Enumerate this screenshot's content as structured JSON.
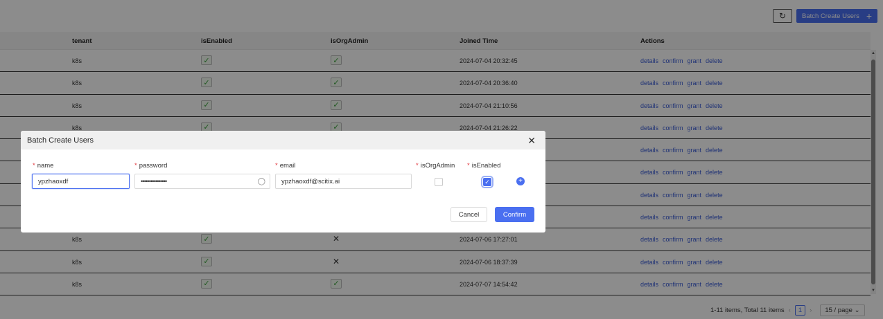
{
  "toolbar": {
    "batch_create_label": "Batch Create Users"
  },
  "table": {
    "columns": [
      "tenant",
      "isEnabled",
      "isOrgAdmin",
      "Joined Time",
      "Actions"
    ],
    "actions": [
      "details",
      "confirm",
      "grant",
      "delete"
    ],
    "rows": [
      {
        "tenant": "k8s",
        "isEnabled": true,
        "isOrgAdmin": true,
        "joined": "2024-07-04 20:32:45"
      },
      {
        "tenant": "k8s",
        "isEnabled": true,
        "isOrgAdmin": true,
        "joined": "2024-07-04 20:36:40"
      },
      {
        "tenant": "k8s",
        "isEnabled": true,
        "isOrgAdmin": true,
        "joined": "2024-07-04 21:10:56"
      },
      {
        "tenant": "k8s",
        "isEnabled": true,
        "isOrgAdmin": true,
        "joined": "2024-07-04 21:26:22"
      },
      {
        "tenant": "",
        "isEnabled": null,
        "isOrgAdmin": null,
        "joined": ""
      },
      {
        "tenant": "",
        "isEnabled": null,
        "isOrgAdmin": null,
        "joined": ""
      },
      {
        "tenant": "",
        "isEnabled": null,
        "isOrgAdmin": null,
        "joined": ""
      },
      {
        "tenant": "",
        "isEnabled": null,
        "isOrgAdmin": null,
        "joined": ""
      },
      {
        "tenant": "k8s",
        "isEnabled": true,
        "isOrgAdmin": false,
        "joined": "2024-07-06 17:27:01"
      },
      {
        "tenant": "k8s",
        "isEnabled": true,
        "isOrgAdmin": false,
        "joined": "2024-07-06 18:37:39"
      },
      {
        "tenant": "k8s",
        "isEnabled": true,
        "isOrgAdmin": true,
        "joined": "2024-07-07 14:54:42"
      }
    ]
  },
  "pagination": {
    "summary": "1-11 items,  Total 11 items",
    "current_page": "1",
    "page_size": "15 / page"
  },
  "modal": {
    "title": "Batch Create Users",
    "fields": {
      "name_label": "name",
      "password_label": "password",
      "email_label": "email",
      "isOrgAdmin_label": "isOrgAdmin",
      "isEnabled_label": "isEnabled"
    },
    "values": {
      "name": "ypzhaoxdf",
      "password": "••••••••••••••••",
      "email": "ypzhaoxdf@scitix.ai",
      "isOrgAdmin": false,
      "isEnabled": true
    },
    "cancel_label": "Cancel",
    "confirm_label": "Confirm"
  },
  "colors": {
    "primary": "#4a6ff0",
    "required": "#e2363c",
    "check": "#39a039"
  }
}
